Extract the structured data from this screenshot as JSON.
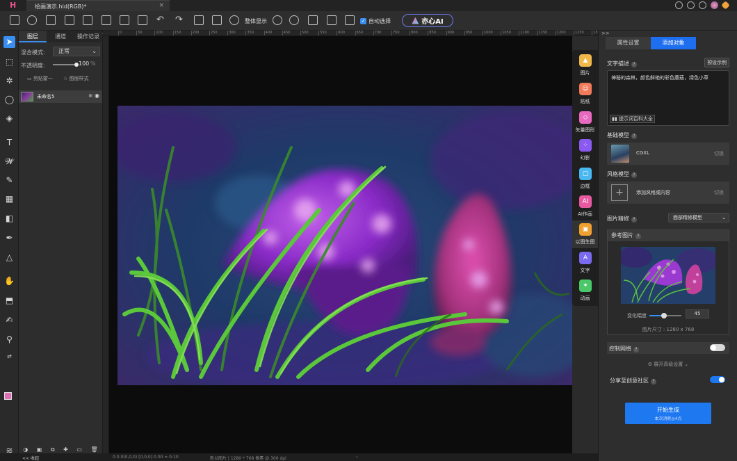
{
  "app": {
    "logo_glyph": "H",
    "document_tab": "绘画演示.hid(RGB)*",
    "close_glyph": "×"
  },
  "toolbar": {
    "zoom_label": "整体显示",
    "auto_select_label": "自动选择",
    "ai_button_label": "亦心AI"
  },
  "layers_panel": {
    "tabs": [
      "图层",
      "通道",
      "操作记录"
    ],
    "blend_label": "混合模式:",
    "blend_value": "正常",
    "opacity_label": "不透明度:",
    "opacity_value": "100",
    "opacity_percent": 100,
    "opacity_unit": "%",
    "clip_mask_label": "剪贴蒙一",
    "layer_style_label": "图层样式",
    "layers": [
      {
        "name": "未命名5",
        "visible": true
      }
    ]
  },
  "ruler": {
    "unit": "像素",
    "ticks": [
      "0",
      "50",
      "100",
      "150",
      "200",
      "250",
      "300",
      "350",
      "400",
      "450",
      "500",
      "550",
      "600",
      "650",
      "700",
      "750",
      "800",
      "850",
      "900",
      "950",
      "1000",
      "1050",
      "1100",
      "1150",
      "1200",
      "1250",
      "1300"
    ]
  },
  "status_bar": {
    "collapse_label": "<< 收起",
    "coords": "0.0.0(0,0,0) [0,0,0] 0.00 ≈ 0:10",
    "doc_info": "新以图片 | 1280 * 768 像素 @ 300 dpi"
  },
  "object_dock": {
    "items": [
      {
        "label": "图片",
        "icon": "image-icon",
        "color": "#f0b84a"
      },
      {
        "label": "贴纸",
        "icon": "sticker-icon",
        "color": "#f07a5a"
      },
      {
        "label": "矢量图形",
        "icon": "vector-icon",
        "color": "#e86ac0"
      },
      {
        "label": "幻影",
        "icon": "phantom-icon",
        "color": "#8a5af0"
      },
      {
        "label": "边框",
        "icon": "frame-icon",
        "color": "#4ab8f0"
      },
      {
        "label": "AI作画",
        "icon": "ai-paint-icon",
        "color": "#e85aa0"
      },
      {
        "label": "以图生图",
        "icon": "image-to-image-icon",
        "color": "#f0a030"
      },
      {
        "label": "文字",
        "icon": "text-icon",
        "color": "#7a6af0"
      },
      {
        "label": "动画",
        "icon": "animation-icon",
        "color": "#4ac86a"
      }
    ],
    "active_index": 6
  },
  "right_panel": {
    "collapse_glyph": ">>",
    "tabs": [
      "属性设置",
      "添加对象"
    ],
    "active_tab": 1,
    "text_desc_label": "文字描述",
    "sample_button": "预设示例",
    "prompt_text": "神秘的森林，颜色鲜艳的彩色蘑菇，绿色小草",
    "prompt_hint": "提示词百科大全",
    "base_model_label": "基础模型",
    "base_model_name": "CGXL",
    "switch_label": "切换",
    "style_model_label": "风格模型",
    "style_model_placeholder": "添加风格或内容",
    "fine_tune_label": "图片精修",
    "fine_tune_value": "面部精修模型",
    "ref_label": "参考图片",
    "strength_label": "变化幅度",
    "strength_value": "45",
    "strength_fraction": 0.45,
    "image_size": "图片尺寸 : 1280 x 768",
    "control_net_label": "控制网络",
    "control_net_on": false,
    "advanced_label": "展开高级设置",
    "share_label": "分享至创意社区",
    "share_on": true,
    "generate_label": "开始生成",
    "generate_sub": "本次消耗◎4点"
  },
  "colors": {
    "accent": "#1e78f0",
    "foreground_swatch": "#e070b8",
    "background_swatch": "#ffffff"
  }
}
